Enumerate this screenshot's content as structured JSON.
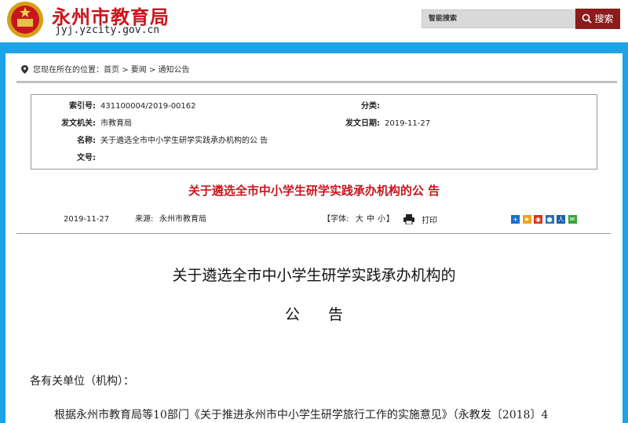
{
  "header": {
    "site_name": "永州市教育局",
    "site_url": "jyj.yzcity.gov.cn",
    "search_placeholder": "智能搜索",
    "search_label": "搜索"
  },
  "breadcrumb": {
    "prefix": "您现在所在的位置：",
    "items": [
      "首页",
      "要闻",
      "通知公告"
    ],
    "separator": ">"
  },
  "meta": {
    "index_label": "索引号:",
    "index_value": "431100004/2019-00162",
    "category_label": "分类:",
    "category_value": "",
    "issuer_label": "发文机关:",
    "issuer_value": "市教育局",
    "date_label": "发文日期:",
    "date_value": "2019-11-27",
    "name_label": "名称:",
    "name_value": "关于遴选全市中小学生研学实践承办机构的公 告",
    "docno_label": "文号:",
    "docno_value": ""
  },
  "doc_title": "关于遴选全市中小学生研学实践承办机构的公 告",
  "info_bar": {
    "date": "2019-11-27",
    "source_label": "来源:",
    "source_value": "永州市教育局",
    "font_label": "【字体:",
    "font_large": "大",
    "font_medium": "中",
    "font_small": "小",
    "font_close": "】",
    "print_label": "打印"
  },
  "share_icons": [
    {
      "name": "share-plus-icon",
      "color": "#1b6fc9",
      "glyph": "+"
    },
    {
      "name": "share-qzone-icon",
      "color": "#f0a318",
      "glyph": "★"
    },
    {
      "name": "share-weibo-icon",
      "color": "#d9321f",
      "glyph": "◉"
    },
    {
      "name": "share-tqq-icon",
      "color": "#2a72b8",
      "glyph": "●"
    },
    {
      "name": "share-renren-icon",
      "color": "#1b5fa6",
      "glyph": "人"
    },
    {
      "name": "share-wechat-icon",
      "color": "#3aa53a",
      "glyph": "✉"
    }
  ],
  "article": {
    "heading_line1": "关于遴选全市中小学生研学实践承办机构的",
    "heading_line2": "公告",
    "salutation": "各有关单位（机构）：",
    "para1": "根据永州市教育局等10部门《关于推进永州市中小学生研学旅行工作的实施意见》（永教发〔2018〕4"
  },
  "colors": {
    "brand_red": "#c8161d",
    "page_blue": "#1fa3e6",
    "search_button": "#8b1c1c"
  }
}
